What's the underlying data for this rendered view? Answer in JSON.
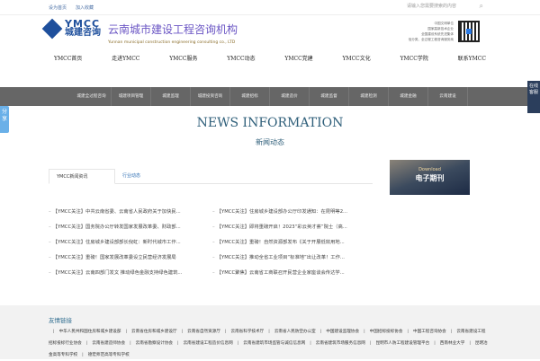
{
  "topbar": {
    "set_home": "设为首页",
    "add_fav": "加入收藏",
    "search_placeholder": "请输入您需要搜索的内容"
  },
  "logo": {
    "en": "YMCC",
    "cn": "城建咨询"
  },
  "org": {
    "cn": "云南城市建设工程咨询机构",
    "en": "Yunnan municipal construction engineering consulting co., LTD"
  },
  "slogan": [
    "中国文明单位",
    "国家高新技术企业",
    "全国建设系统先进集体",
    "信分类、全过程工程咨询服务商"
  ],
  "nav": [
    "YMCC首页",
    "走进YMCC",
    "YMCC服务",
    "YMCC动态",
    "YMCC党建",
    "YMCC文化",
    "YMCC学院",
    "联系YMCC"
  ],
  "services": [
    "城建全过程咨询",
    "城建项目管理",
    "城建监理",
    "城建投资咨询",
    "城建招标",
    "城建造价",
    "城建监督",
    "城建检测",
    "城建金融",
    "云南建设"
  ],
  "share": "分享",
  "qq": "在线客服",
  "section": {
    "title_en": "NEWS INFORMATION",
    "title_cn": "新闻动态"
  },
  "tabs": [
    "YMCC新闻资讯",
    "行业动态"
  ],
  "banner": {
    "download": "Download",
    "label": "电子期刊"
  },
  "news_left": [
    "【YMCC关注】中共云南省委、云南省人民政府关于加快民...",
    "【YMCC关注】国务院办公厅转发国家发展改革委、财政部...",
    "【YMCC关注】住房城乡建设部部长倪虹：新时代城市工作...",
    "【YMCC关注】重磅！国家发展改革委设立民营经济发展局",
    "【YMCC关注】云南四部门发文 推动绿色金融支持绿色建筑..."
  ],
  "news_right": [
    "【YMCC关注】住房城乡建设部办公厅印发通知：在昆明等2...",
    "【YMCC关注】即将重磅开启！2023“彩云英才荟”院士（高...",
    "【YMCC关注】重磅！自然资源部发布《关于开展低效用地...",
    "【YMCC关注】推动全省工业项目“标准地”出让改革！工作...",
    "【YMCC聚焦】云南省工商联召开民营企业家座谈会传达学..."
  ],
  "footer": {
    "heading": "友情链接",
    "links": [
      "中华人民共和国住房和城乡建设部",
      "云南省住房和城乡建设厅",
      "云南省自然资源厅",
      "云南省科学技术厅",
      "云南省人民防空办公室",
      "中国建设监理协会",
      "中国招标投标协会",
      "中国工程咨询协会",
      "云南省建设工程招标投标行业协会",
      "云南省建造师协会",
      "云南省勘察设计协会",
      "云南省建设工程造价信息网",
      "云南省建筑市场监管与诚信信息网",
      "云南省建筑市场服务信息网",
      "昆明市人防工程建设管理平台",
      "西南林业大学",
      "昆明冶金高等专科学校",
      "德宏师范高等专科学校"
    ]
  }
}
